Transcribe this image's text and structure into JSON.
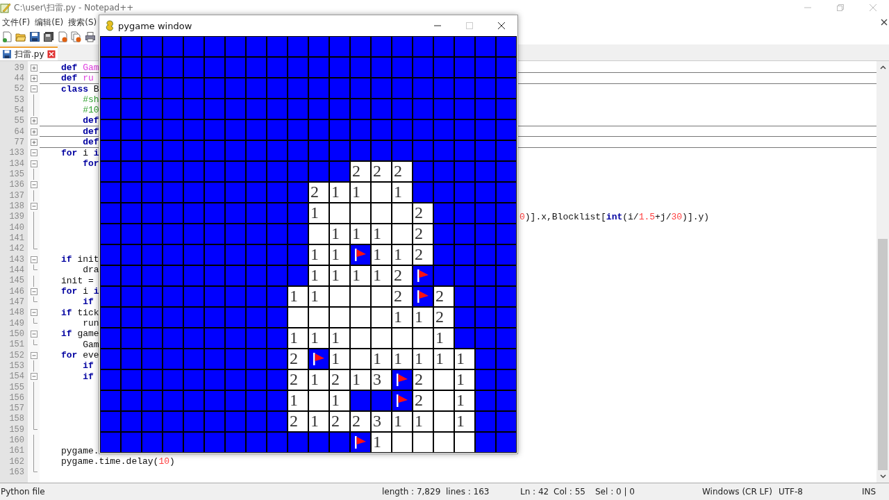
{
  "notepad": {
    "title": "C:\\user\\扫雷.py - Notepad++",
    "menu": [
      "文件(F)",
      "编辑(E)",
      "搜索(S)"
    ],
    "tabs": [
      {
        "label": "扫雷.py",
        "selected": true
      }
    ],
    "editor": {
      "lines": [
        {
          "number": "39",
          "kind": "folded",
          "tokens": [
            {
              "kind": "keyword",
              "text": "def"
            },
            {
              "kind": "function",
              "text": " Gam"
            }
          ]
        },
        {
          "number": "44",
          "kind": "folded",
          "tokens": [
            {
              "kind": "keyword",
              "text": "def"
            },
            {
              "kind": "function",
              "text": " ru"
            }
          ]
        },
        {
          "number": "52",
          "kind": "open",
          "tokens": [
            {
              "kind": "keyword",
              "text": "class"
            },
            {
              "kind": "plain",
              "text": " B"
            }
          ]
        },
        {
          "number": "53",
          "kind": "body",
          "tokens": [
            {
              "kind": "comment",
              "text": "    #sh"
            }
          ]
        },
        {
          "number": "54",
          "kind": "body",
          "tokens": [
            {
              "kind": "comment",
              "text": "    #10"
            }
          ]
        },
        {
          "number": "55",
          "kind": "folded",
          "tokens": [
            {
              "kind": "keyword",
              "text": "    def"
            }
          ]
        },
        {
          "number": "64",
          "kind": "folded",
          "tokens": [
            {
              "kind": "keyword",
              "text": "    def"
            }
          ]
        },
        {
          "number": "77",
          "kind": "folded",
          "tokens": [
            {
              "kind": "keyword",
              "text": "    def"
            }
          ]
        },
        {
          "number": "133",
          "kind": "open",
          "tokens": [
            {
              "kind": "keyword",
              "text": "for"
            },
            {
              "kind": "plain",
              "text": " i "
            },
            {
              "kind": "keyword",
              "text": "i"
            }
          ]
        },
        {
          "number": "134",
          "kind": "open",
          "tokens": [
            {
              "kind": "keyword",
              "text": "    for"
            }
          ]
        },
        {
          "number": "135",
          "kind": "body"
        },
        {
          "number": "136",
          "kind": "open"
        },
        {
          "number": "137",
          "kind": "body"
        },
        {
          "number": "138",
          "kind": "open"
        },
        {
          "number": "139",
          "kind": "body",
          "tail": [
            {
              "kind": "number",
              "text": "0"
            },
            {
              "kind": "plain",
              "text": ")].x,Blocklist["
            },
            {
              "kind": "keyword",
              "text": "int"
            },
            {
              "kind": "plain",
              "text": "(i/"
            },
            {
              "kind": "number",
              "text": "1.5"
            },
            {
              "kind": "plain",
              "text": "+j/"
            },
            {
              "kind": "number",
              "text": "30"
            },
            {
              "kind": "plain",
              "text": ")].y)"
            }
          ]
        },
        {
          "number": "140",
          "kind": "body"
        },
        {
          "number": "141",
          "kind": "body"
        },
        {
          "number": "142",
          "kind": "end"
        },
        {
          "number": "143",
          "kind": "open",
          "tokens": [
            {
              "kind": "keyword",
              "text": "if"
            },
            {
              "kind": "plain",
              "text": " init"
            }
          ]
        },
        {
          "number": "144",
          "kind": "end",
          "tokens": [
            {
              "kind": "plain",
              "text": "    dra"
            }
          ]
        },
        {
          "number": "145",
          "kind": "body",
          "tokens": [
            {
              "kind": "plain",
              "text": "init ="
            }
          ]
        },
        {
          "number": "146",
          "kind": "open",
          "tokens": [
            {
              "kind": "keyword",
              "text": "for"
            },
            {
              "kind": "plain",
              "text": " i "
            },
            {
              "kind": "keyword",
              "text": "i"
            }
          ]
        },
        {
          "number": "147",
          "kind": "end",
          "tokens": [
            {
              "kind": "keyword",
              "text": "    if"
            }
          ]
        },
        {
          "number": "148",
          "kind": "open",
          "tokens": [
            {
              "kind": "keyword",
              "text": "if"
            },
            {
              "kind": "plain",
              "text": " tick"
            }
          ]
        },
        {
          "number": "149",
          "kind": "end",
          "tokens": [
            {
              "kind": "plain",
              "text": "    run"
            }
          ]
        },
        {
          "number": "150",
          "kind": "open",
          "tokens": [
            {
              "kind": "keyword",
              "text": "if"
            },
            {
              "kind": "plain",
              "text": " game"
            }
          ]
        },
        {
          "number": "151",
          "kind": "end",
          "tokens": [
            {
              "kind": "plain",
              "text": "    Gam"
            }
          ]
        },
        {
          "number": "152",
          "kind": "open",
          "tokens": [
            {
              "kind": "keyword",
              "text": "for"
            },
            {
              "kind": "plain",
              "text": " eve"
            }
          ]
        },
        {
          "number": "153",
          "kind": "body",
          "tokens": [
            {
              "kind": "keyword",
              "text": "    if"
            }
          ]
        },
        {
          "number": "154",
          "kind": "open",
          "tokens": [
            {
              "kind": "keyword",
              "text": "    if"
            }
          ]
        },
        {
          "number": "155",
          "kind": "body"
        },
        {
          "number": "156",
          "kind": "body"
        },
        {
          "number": "157",
          "kind": "body"
        },
        {
          "number": "158",
          "kind": "body"
        },
        {
          "number": "159",
          "kind": "end"
        },
        {
          "number": "160",
          "kind": "body"
        },
        {
          "number": "161",
          "kind": "body",
          "tokens": [
            {
              "kind": "plain",
              "text": "pygame."
            }
          ]
        },
        {
          "number": "162",
          "kind": "body",
          "tokens": [
            {
              "kind": "plain",
              "text": "pygame.time.delay("
            },
            {
              "kind": "number",
              "text": "10"
            },
            {
              "kind": "plain",
              "text": ")"
            }
          ]
        },
        {
          "number": "163",
          "kind": "end"
        }
      ]
    },
    "status_bar": [
      "Python file",
      "length : 7,829",
      "lines : 163",
      "Ln : 42",
      "Col : 55",
      "Sel : 0 | 0",
      "Windows (CR LF)",
      "UTF-8",
      "INS"
    ]
  },
  "pygame_window": {
    "title": "pygame window",
    "board": {
      "rows": [
        {
          "cells": [
            {
              "kind": "covered"
            },
            {
              "kind": "covered"
            },
            {
              "kind": "covered"
            },
            {
              "kind": "covered"
            },
            {
              "kind": "covered"
            },
            {
              "kind": "covered"
            },
            {
              "kind": "covered"
            },
            {
              "kind": "covered"
            },
            {
              "kind": "covered"
            },
            {
              "kind": "covered"
            },
            {
              "kind": "covered"
            },
            {
              "kind": "covered"
            },
            {
              "kind": "covered"
            },
            {
              "kind": "covered"
            },
            {
              "kind": "covered"
            },
            {
              "kind": "covered"
            },
            {
              "kind": "covered"
            },
            {
              "kind": "covered"
            },
            {
              "kind": "covered"
            },
            {
              "kind": "covered"
            }
          ]
        },
        {
          "cells": [
            {
              "kind": "covered"
            },
            {
              "kind": "covered"
            },
            {
              "kind": "covered"
            },
            {
              "kind": "covered"
            },
            {
              "kind": "covered"
            },
            {
              "kind": "covered"
            },
            {
              "kind": "covered"
            },
            {
              "kind": "covered"
            },
            {
              "kind": "covered"
            },
            {
              "kind": "covered"
            },
            {
              "kind": "covered"
            },
            {
              "kind": "covered"
            },
            {
              "kind": "covered"
            },
            {
              "kind": "covered"
            },
            {
              "kind": "covered"
            },
            {
              "kind": "covered"
            },
            {
              "kind": "covered"
            },
            {
              "kind": "covered"
            },
            {
              "kind": "covered"
            },
            {
              "kind": "covered"
            }
          ]
        },
        {
          "cells": [
            {
              "kind": "covered"
            },
            {
              "kind": "covered"
            },
            {
              "kind": "covered"
            },
            {
              "kind": "covered"
            },
            {
              "kind": "covered"
            },
            {
              "kind": "covered"
            },
            {
              "kind": "covered"
            },
            {
              "kind": "covered"
            },
            {
              "kind": "covered"
            },
            {
              "kind": "covered"
            },
            {
              "kind": "covered"
            },
            {
              "kind": "covered"
            },
            {
              "kind": "covered"
            },
            {
              "kind": "covered"
            },
            {
              "kind": "covered"
            },
            {
              "kind": "covered"
            },
            {
              "kind": "covered"
            },
            {
              "kind": "covered"
            },
            {
              "kind": "covered"
            },
            {
              "kind": "covered"
            }
          ]
        },
        {
          "cells": [
            {
              "kind": "covered"
            },
            {
              "kind": "covered"
            },
            {
              "kind": "covered"
            },
            {
              "kind": "covered"
            },
            {
              "kind": "covered"
            },
            {
              "kind": "covered"
            },
            {
              "kind": "covered"
            },
            {
              "kind": "covered"
            },
            {
              "kind": "covered"
            },
            {
              "kind": "covered"
            },
            {
              "kind": "covered"
            },
            {
              "kind": "covered"
            },
            {
              "kind": "covered"
            },
            {
              "kind": "covered"
            },
            {
              "kind": "covered"
            },
            {
              "kind": "covered"
            },
            {
              "kind": "covered"
            },
            {
              "kind": "covered"
            },
            {
              "kind": "covered"
            },
            {
              "kind": "covered"
            }
          ]
        },
        {
          "cells": [
            {
              "kind": "covered"
            },
            {
              "kind": "covered"
            },
            {
              "kind": "covered"
            },
            {
              "kind": "covered"
            },
            {
              "kind": "covered"
            },
            {
              "kind": "covered"
            },
            {
              "kind": "covered"
            },
            {
              "kind": "covered"
            },
            {
              "kind": "covered"
            },
            {
              "kind": "covered"
            },
            {
              "kind": "covered"
            },
            {
              "kind": "covered"
            },
            {
              "kind": "covered"
            },
            {
              "kind": "covered"
            },
            {
              "kind": "covered"
            },
            {
              "kind": "covered"
            },
            {
              "kind": "covered"
            },
            {
              "kind": "covered"
            },
            {
              "kind": "covered"
            },
            {
              "kind": "covered"
            }
          ]
        },
        {
          "cells": [
            {
              "kind": "covered"
            },
            {
              "kind": "covered"
            },
            {
              "kind": "covered"
            },
            {
              "kind": "covered"
            },
            {
              "kind": "covered"
            },
            {
              "kind": "covered"
            },
            {
              "kind": "covered"
            },
            {
              "kind": "covered"
            },
            {
              "kind": "covered"
            },
            {
              "kind": "covered"
            },
            {
              "kind": "covered"
            },
            {
              "kind": "covered"
            },
            {
              "kind": "covered"
            },
            {
              "kind": "covered"
            },
            {
              "kind": "covered"
            },
            {
              "kind": "covered"
            },
            {
              "kind": "covered"
            },
            {
              "kind": "covered"
            },
            {
              "kind": "covered"
            },
            {
              "kind": "covered"
            }
          ]
        },
        {
          "cells": [
            {
              "kind": "covered"
            },
            {
              "kind": "covered"
            },
            {
              "kind": "covered"
            },
            {
              "kind": "covered"
            },
            {
              "kind": "covered"
            },
            {
              "kind": "covered"
            },
            {
              "kind": "covered"
            },
            {
              "kind": "covered"
            },
            {
              "kind": "covered"
            },
            {
              "kind": "covered"
            },
            {
              "kind": "covered"
            },
            {
              "kind": "covered"
            },
            {
              "kind": "number",
              "text": "2"
            },
            {
              "kind": "number",
              "text": "2"
            },
            {
              "kind": "number",
              "text": "2"
            },
            {
              "kind": "covered"
            },
            {
              "kind": "covered"
            },
            {
              "kind": "covered"
            },
            {
              "kind": "covered"
            },
            {
              "kind": "covered"
            }
          ]
        },
        {
          "cells": [
            {
              "kind": "covered"
            },
            {
              "kind": "covered"
            },
            {
              "kind": "covered"
            },
            {
              "kind": "covered"
            },
            {
              "kind": "covered"
            },
            {
              "kind": "covered"
            },
            {
              "kind": "covered"
            },
            {
              "kind": "covered"
            },
            {
              "kind": "covered"
            },
            {
              "kind": "covered"
            },
            {
              "kind": "number",
              "text": "2"
            },
            {
              "kind": "number",
              "text": "1"
            },
            {
              "kind": "number",
              "text": "1"
            },
            {
              "kind": "open"
            },
            {
              "kind": "number",
              "text": "1"
            },
            {
              "kind": "covered"
            },
            {
              "kind": "covered"
            },
            {
              "kind": "covered"
            },
            {
              "kind": "covered"
            },
            {
              "kind": "covered"
            }
          ]
        },
        {
          "cells": [
            {
              "kind": "covered"
            },
            {
              "kind": "covered"
            },
            {
              "kind": "covered"
            },
            {
              "kind": "covered"
            },
            {
              "kind": "covered"
            },
            {
              "kind": "covered"
            },
            {
              "kind": "covered"
            },
            {
              "kind": "covered"
            },
            {
              "kind": "covered"
            },
            {
              "kind": "covered"
            },
            {
              "kind": "number",
              "text": "1"
            },
            {
              "kind": "open"
            },
            {
              "kind": "open"
            },
            {
              "kind": "open"
            },
            {
              "kind": "open"
            },
            {
              "kind": "number",
              "text": "2"
            },
            {
              "kind": "covered"
            },
            {
              "kind": "covered"
            },
            {
              "kind": "covered"
            },
            {
              "kind": "covered"
            }
          ]
        },
        {
          "cells": [
            {
              "kind": "covered"
            },
            {
              "kind": "covered"
            },
            {
              "kind": "covered"
            },
            {
              "kind": "covered"
            },
            {
              "kind": "covered"
            },
            {
              "kind": "covered"
            },
            {
              "kind": "covered"
            },
            {
              "kind": "covered"
            },
            {
              "kind": "covered"
            },
            {
              "kind": "covered"
            },
            {
              "kind": "open"
            },
            {
              "kind": "number",
              "text": "1"
            },
            {
              "kind": "number",
              "text": "1"
            },
            {
              "kind": "number",
              "text": "1"
            },
            {
              "kind": "open"
            },
            {
              "kind": "number",
              "text": "2"
            },
            {
              "kind": "covered"
            },
            {
              "kind": "covered"
            },
            {
              "kind": "covered"
            },
            {
              "kind": "covered"
            }
          ]
        },
        {
          "cells": [
            {
              "kind": "covered"
            },
            {
              "kind": "covered"
            },
            {
              "kind": "covered"
            },
            {
              "kind": "covered"
            },
            {
              "kind": "covered"
            },
            {
              "kind": "covered"
            },
            {
              "kind": "covered"
            },
            {
              "kind": "covered"
            },
            {
              "kind": "covered"
            },
            {
              "kind": "covered"
            },
            {
              "kind": "number",
              "text": "1"
            },
            {
              "kind": "number",
              "text": "1"
            },
            {
              "kind": "flag"
            },
            {
              "kind": "number",
              "text": "1"
            },
            {
              "kind": "number",
              "text": "1"
            },
            {
              "kind": "number",
              "text": "2"
            },
            {
              "kind": "covered"
            },
            {
              "kind": "covered"
            },
            {
              "kind": "covered"
            },
            {
              "kind": "covered"
            }
          ]
        },
        {
          "cells": [
            {
              "kind": "covered"
            },
            {
              "kind": "covered"
            },
            {
              "kind": "covered"
            },
            {
              "kind": "covered"
            },
            {
              "kind": "covered"
            },
            {
              "kind": "covered"
            },
            {
              "kind": "covered"
            },
            {
              "kind": "covered"
            },
            {
              "kind": "covered"
            },
            {
              "kind": "covered"
            },
            {
              "kind": "number",
              "text": "1"
            },
            {
              "kind": "number",
              "text": "1"
            },
            {
              "kind": "number",
              "text": "1"
            },
            {
              "kind": "number",
              "text": "1"
            },
            {
              "kind": "number",
              "text": "2"
            },
            {
              "kind": "flag"
            },
            {
              "kind": "covered"
            },
            {
              "kind": "covered"
            },
            {
              "kind": "covered"
            },
            {
              "kind": "covered"
            }
          ]
        },
        {
          "cells": [
            {
              "kind": "covered"
            },
            {
              "kind": "covered"
            },
            {
              "kind": "covered"
            },
            {
              "kind": "covered"
            },
            {
              "kind": "covered"
            },
            {
              "kind": "covered"
            },
            {
              "kind": "covered"
            },
            {
              "kind": "covered"
            },
            {
              "kind": "covered"
            },
            {
              "kind": "number",
              "text": "1"
            },
            {
              "kind": "number",
              "text": "1"
            },
            {
              "kind": "open"
            },
            {
              "kind": "open"
            },
            {
              "kind": "open"
            },
            {
              "kind": "number",
              "text": "2"
            },
            {
              "kind": "flag"
            },
            {
              "kind": "number",
              "text": "2"
            },
            {
              "kind": "covered"
            },
            {
              "kind": "covered"
            },
            {
              "kind": "covered"
            }
          ]
        },
        {
          "cells": [
            {
              "kind": "covered"
            },
            {
              "kind": "covered"
            },
            {
              "kind": "covered"
            },
            {
              "kind": "covered"
            },
            {
              "kind": "covered"
            },
            {
              "kind": "covered"
            },
            {
              "kind": "covered"
            },
            {
              "kind": "covered"
            },
            {
              "kind": "covered"
            },
            {
              "kind": "open"
            },
            {
              "kind": "open"
            },
            {
              "kind": "open"
            },
            {
              "kind": "open"
            },
            {
              "kind": "open"
            },
            {
              "kind": "number",
              "text": "1"
            },
            {
              "kind": "number",
              "text": "1"
            },
            {
              "kind": "number",
              "text": "2"
            },
            {
              "kind": "covered"
            },
            {
              "kind": "covered"
            },
            {
              "kind": "covered"
            }
          ]
        },
        {
          "cells": [
            {
              "kind": "covered"
            },
            {
              "kind": "covered"
            },
            {
              "kind": "covered"
            },
            {
              "kind": "covered"
            },
            {
              "kind": "covered"
            },
            {
              "kind": "covered"
            },
            {
              "kind": "covered"
            },
            {
              "kind": "covered"
            },
            {
              "kind": "covered"
            },
            {
              "kind": "number",
              "text": "1"
            },
            {
              "kind": "number",
              "text": "1"
            },
            {
              "kind": "number",
              "text": "1"
            },
            {
              "kind": "open"
            },
            {
              "kind": "open"
            },
            {
              "kind": "open"
            },
            {
              "kind": "open"
            },
            {
              "kind": "number",
              "text": "1"
            },
            {
              "kind": "covered"
            },
            {
              "kind": "covered"
            },
            {
              "kind": "covered"
            }
          ]
        },
        {
          "cells": [
            {
              "kind": "covered"
            },
            {
              "kind": "covered"
            },
            {
              "kind": "covered"
            },
            {
              "kind": "covered"
            },
            {
              "kind": "covered"
            },
            {
              "kind": "covered"
            },
            {
              "kind": "covered"
            },
            {
              "kind": "covered"
            },
            {
              "kind": "covered"
            },
            {
              "kind": "number",
              "text": "2"
            },
            {
              "kind": "flag"
            },
            {
              "kind": "number",
              "text": "1"
            },
            {
              "kind": "open"
            },
            {
              "kind": "number",
              "text": "1"
            },
            {
              "kind": "number",
              "text": "1"
            },
            {
              "kind": "number",
              "text": "1"
            },
            {
              "kind": "number",
              "text": "1"
            },
            {
              "kind": "number",
              "text": "1"
            },
            {
              "kind": "covered"
            },
            {
              "kind": "covered"
            }
          ]
        },
        {
          "cells": [
            {
              "kind": "covered"
            },
            {
              "kind": "covered"
            },
            {
              "kind": "covered"
            },
            {
              "kind": "covered"
            },
            {
              "kind": "covered"
            },
            {
              "kind": "covered"
            },
            {
              "kind": "covered"
            },
            {
              "kind": "covered"
            },
            {
              "kind": "covered"
            },
            {
              "kind": "number",
              "text": "2"
            },
            {
              "kind": "number",
              "text": "1"
            },
            {
              "kind": "number",
              "text": "2"
            },
            {
              "kind": "number",
              "text": "1"
            },
            {
              "kind": "number",
              "text": "3"
            },
            {
              "kind": "flag"
            },
            {
              "kind": "number",
              "text": "2"
            },
            {
              "kind": "open"
            },
            {
              "kind": "number",
              "text": "1"
            },
            {
              "kind": "covered"
            },
            {
              "kind": "covered"
            }
          ]
        },
        {
          "cells": [
            {
              "kind": "covered"
            },
            {
              "kind": "covered"
            },
            {
              "kind": "covered"
            },
            {
              "kind": "covered"
            },
            {
              "kind": "covered"
            },
            {
              "kind": "covered"
            },
            {
              "kind": "covered"
            },
            {
              "kind": "covered"
            },
            {
              "kind": "covered"
            },
            {
              "kind": "number",
              "text": "1"
            },
            {
              "kind": "open"
            },
            {
              "kind": "number",
              "text": "1"
            },
            {
              "kind": "covered"
            },
            {
              "kind": "covered"
            },
            {
              "kind": "flag"
            },
            {
              "kind": "number",
              "text": "2"
            },
            {
              "kind": "open"
            },
            {
              "kind": "number",
              "text": "1"
            },
            {
              "kind": "covered"
            },
            {
              "kind": "covered"
            }
          ]
        },
        {
          "cells": [
            {
              "kind": "covered"
            },
            {
              "kind": "covered"
            },
            {
              "kind": "covered"
            },
            {
              "kind": "covered"
            },
            {
              "kind": "covered"
            },
            {
              "kind": "covered"
            },
            {
              "kind": "covered"
            },
            {
              "kind": "covered"
            },
            {
              "kind": "covered"
            },
            {
              "kind": "number",
              "text": "2"
            },
            {
              "kind": "number",
              "text": "1"
            },
            {
              "kind": "number",
              "text": "2"
            },
            {
              "kind": "number",
              "text": "2"
            },
            {
              "kind": "number",
              "text": "3"
            },
            {
              "kind": "number",
              "text": "1"
            },
            {
              "kind": "number",
              "text": "1"
            },
            {
              "kind": "open"
            },
            {
              "kind": "number",
              "text": "1"
            },
            {
              "kind": "covered"
            },
            {
              "kind": "covered"
            }
          ]
        },
        {
          "cells": [
            {
              "kind": "covered"
            },
            {
              "kind": "covered"
            },
            {
              "kind": "covered"
            },
            {
              "kind": "covered"
            },
            {
              "kind": "covered"
            },
            {
              "kind": "covered"
            },
            {
              "kind": "covered"
            },
            {
              "kind": "covered"
            },
            {
              "kind": "covered"
            },
            {
              "kind": "covered"
            },
            {
              "kind": "covered"
            },
            {
              "kind": "covered"
            },
            {
              "kind": "flag"
            },
            {
              "kind": "number",
              "text": "1"
            },
            {
              "kind": "open"
            },
            {
              "kind": "open"
            },
            {
              "kind": "open"
            },
            {
              "kind": "open"
            },
            {
              "kind": "covered"
            },
            {
              "kind": "covered"
            }
          ]
        }
      ]
    }
  }
}
